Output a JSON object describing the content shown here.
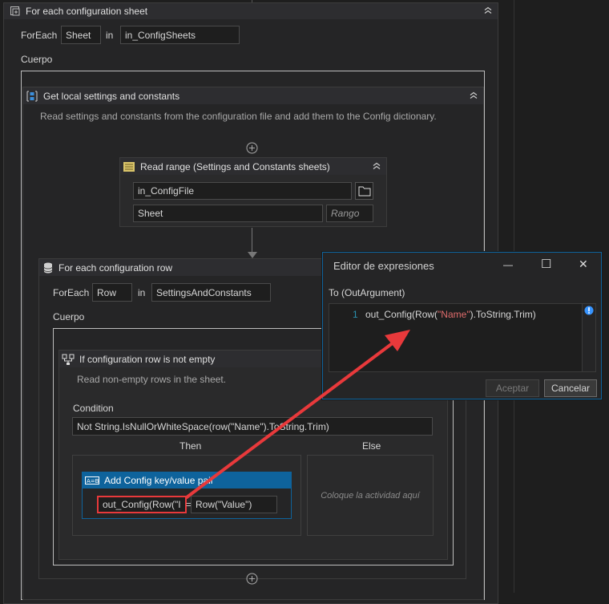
{
  "outer": {
    "title": "For each configuration sheet",
    "foreach_label": "ForEach",
    "item_var": "Sheet",
    "in_label": "in",
    "collection": "in_ConfigSheets",
    "body_label": "Cuerpo"
  },
  "settings": {
    "title": "Get local settings and constants",
    "description": "Read settings and constants from the configuration file and add them to the Config dictionary."
  },
  "read_range": {
    "title": "Read range (Settings and Constants sheets)",
    "file": "in_ConfigFile",
    "sheet": "Sheet",
    "range_placeholder": "Rango"
  },
  "row_loop": {
    "title": "For each configuration row",
    "foreach_label": "ForEach",
    "item_var": "Row",
    "in_label": "in",
    "collection": "SettingsAndConstants",
    "body_label": "Cuerpo"
  },
  "if_block": {
    "title": "If configuration row is not empty",
    "description": "Read non-empty rows in the sheet.",
    "condition_label": "Condition",
    "condition": "Not String.IsNullOrWhiteSpace(row(\"Name\").ToString.Trim)",
    "then_label": "Then",
    "else_label": "Else",
    "else_placeholder": "Coloque la actividad aquí"
  },
  "assign": {
    "title": "Add Config key/value pair",
    "to_value": "out_Config(Row(\"I",
    "eq": "=",
    "from_value": "Row(\"Value\")"
  },
  "expr_editor": {
    "title": "Editor de expresiones",
    "arg_label": "To (OutArgument)",
    "line_number": "1",
    "code_pre": "out_Config(Row(",
    "code_str": "\"Name\"",
    "code_post": ").ToString.Trim)",
    "accept_label": "Aceptar",
    "cancel_label": "Cancelar",
    "minimize_glyph": "—",
    "maximize_glyph": "☐",
    "close_glyph": "✕"
  },
  "colors": {
    "accent_blue": "#0e639c",
    "annotation_red": "#e8393b",
    "string_red": "#e06c6c"
  },
  "icons": [
    "foreach-icon",
    "settings-sequence-icon",
    "excel-read-icon",
    "folder-icon",
    "database-icon",
    "if-icon",
    "assign-icon",
    "info-icon",
    "add-icon",
    "collapse-chevron-icon"
  ]
}
